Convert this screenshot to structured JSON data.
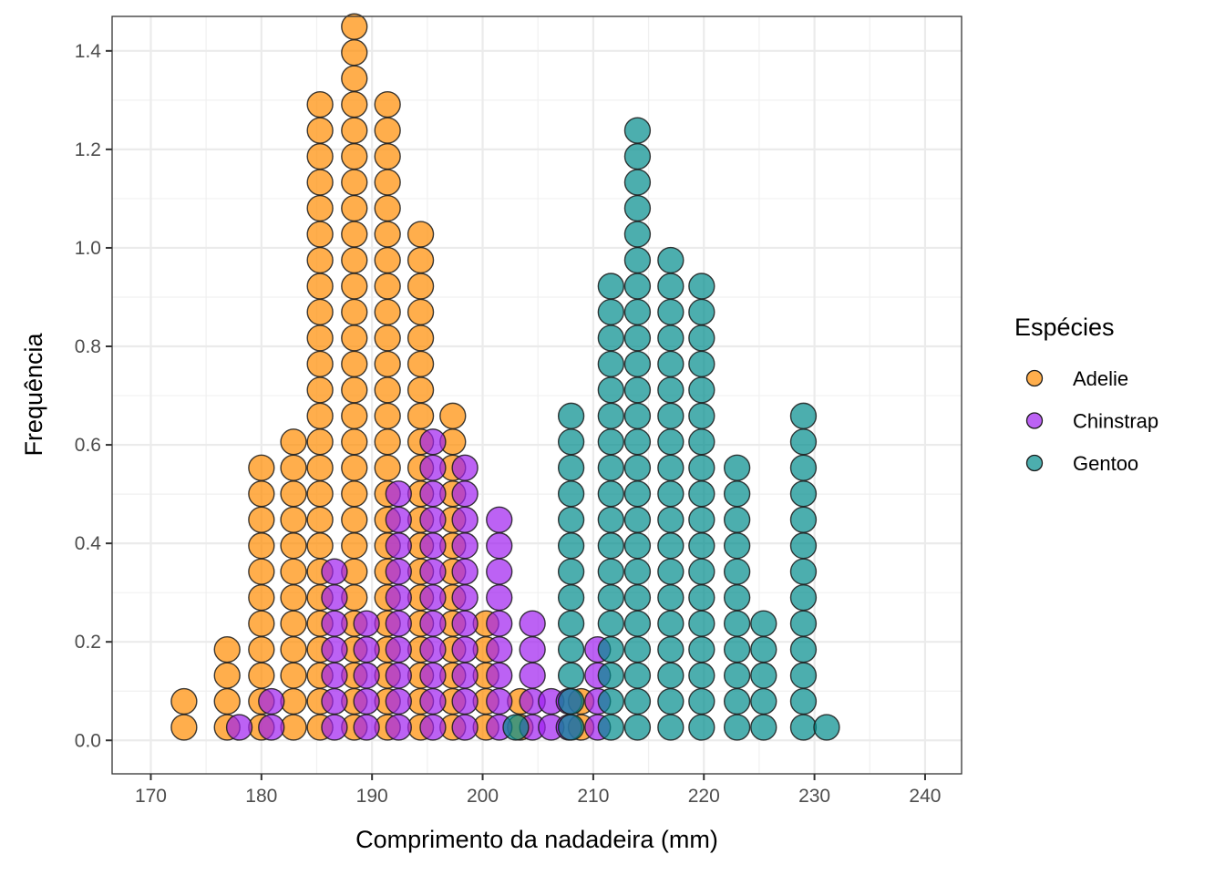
{
  "chart_data": {
    "type": "dotplot",
    "title": "",
    "xlabel": "Comprimento da nadadeira (mm)",
    "ylabel": "Frequência",
    "xlim": [
      166.5,
      243.3
    ],
    "ylim": [
      -0.068,
      1.47
    ],
    "x_ticks": [
      170,
      180,
      190,
      200,
      210,
      220,
      230,
      240
    ],
    "x_tick_labels": [
      "170",
      "180",
      "190",
      "200",
      "210",
      "220",
      "230",
      "240"
    ],
    "y_ticks": [
      0.0,
      0.2,
      0.4,
      0.6,
      0.8,
      1.0,
      1.2,
      1.4
    ],
    "y_tick_labels": [
      "0.0",
      "0.2",
      "0.4",
      "0.6",
      "0.8",
      "1.0",
      "1.2",
      "1.4"
    ],
    "grid": true,
    "dot_step": 0.0527,
    "legend": {
      "title": "Espécies",
      "position": "right"
    },
    "series": [
      {
        "name": "Adelie",
        "color": "#FF8C00",
        "stacks": [
          {
            "x": 173.0,
            "count": 2
          },
          {
            "x": 176.9,
            "count": 4
          },
          {
            "x": 180.0,
            "count": 11
          },
          {
            "x": 182.9,
            "count": 12
          },
          {
            "x": 185.3,
            "count": 25
          },
          {
            "x": 188.4,
            "count": 28
          },
          {
            "x": 191.4,
            "count": 25
          },
          {
            "x": 194.4,
            "count": 20
          },
          {
            "x": 197.3,
            "count": 13
          },
          {
            "x": 200.3,
            "count": 5
          },
          {
            "x": 203.4,
            "count": 2
          },
          {
            "x": 208.9,
            "count": 2
          }
        ]
      },
      {
        "name": "Chinstrap",
        "color": "#A020F0",
        "stacks": [
          {
            "x": 178.0,
            "count": 1
          },
          {
            "x": 180.9,
            "count": 2
          },
          {
            "x": 186.6,
            "count": 7
          },
          {
            "x": 189.5,
            "count": 5
          },
          {
            "x": 192.4,
            "count": 10
          },
          {
            "x": 195.5,
            "count": 12
          },
          {
            "x": 198.4,
            "count": 11
          },
          {
            "x": 201.5,
            "count": 9
          },
          {
            "x": 204.5,
            "count": 5
          },
          {
            "x": 206.2,
            "count": 2
          },
          {
            "x": 207.8,
            "count": 2
          },
          {
            "x": 210.4,
            "count": 4
          }
        ]
      },
      {
        "name": "Gentoo",
        "color": "#008B8B",
        "stacks": [
          {
            "x": 203.0,
            "count": 1
          },
          {
            "x": 208.0,
            "count": 13
          },
          {
            "x": 211.6,
            "count": 18
          },
          {
            "x": 214.0,
            "count": 24
          },
          {
            "x": 217.0,
            "count": 19
          },
          {
            "x": 219.8,
            "count": 18
          },
          {
            "x": 223.0,
            "count": 11
          },
          {
            "x": 225.4,
            "count": 5
          },
          {
            "x": 229.0,
            "count": 13
          },
          {
            "x": 231.1,
            "count": 1
          }
        ]
      }
    ]
  }
}
